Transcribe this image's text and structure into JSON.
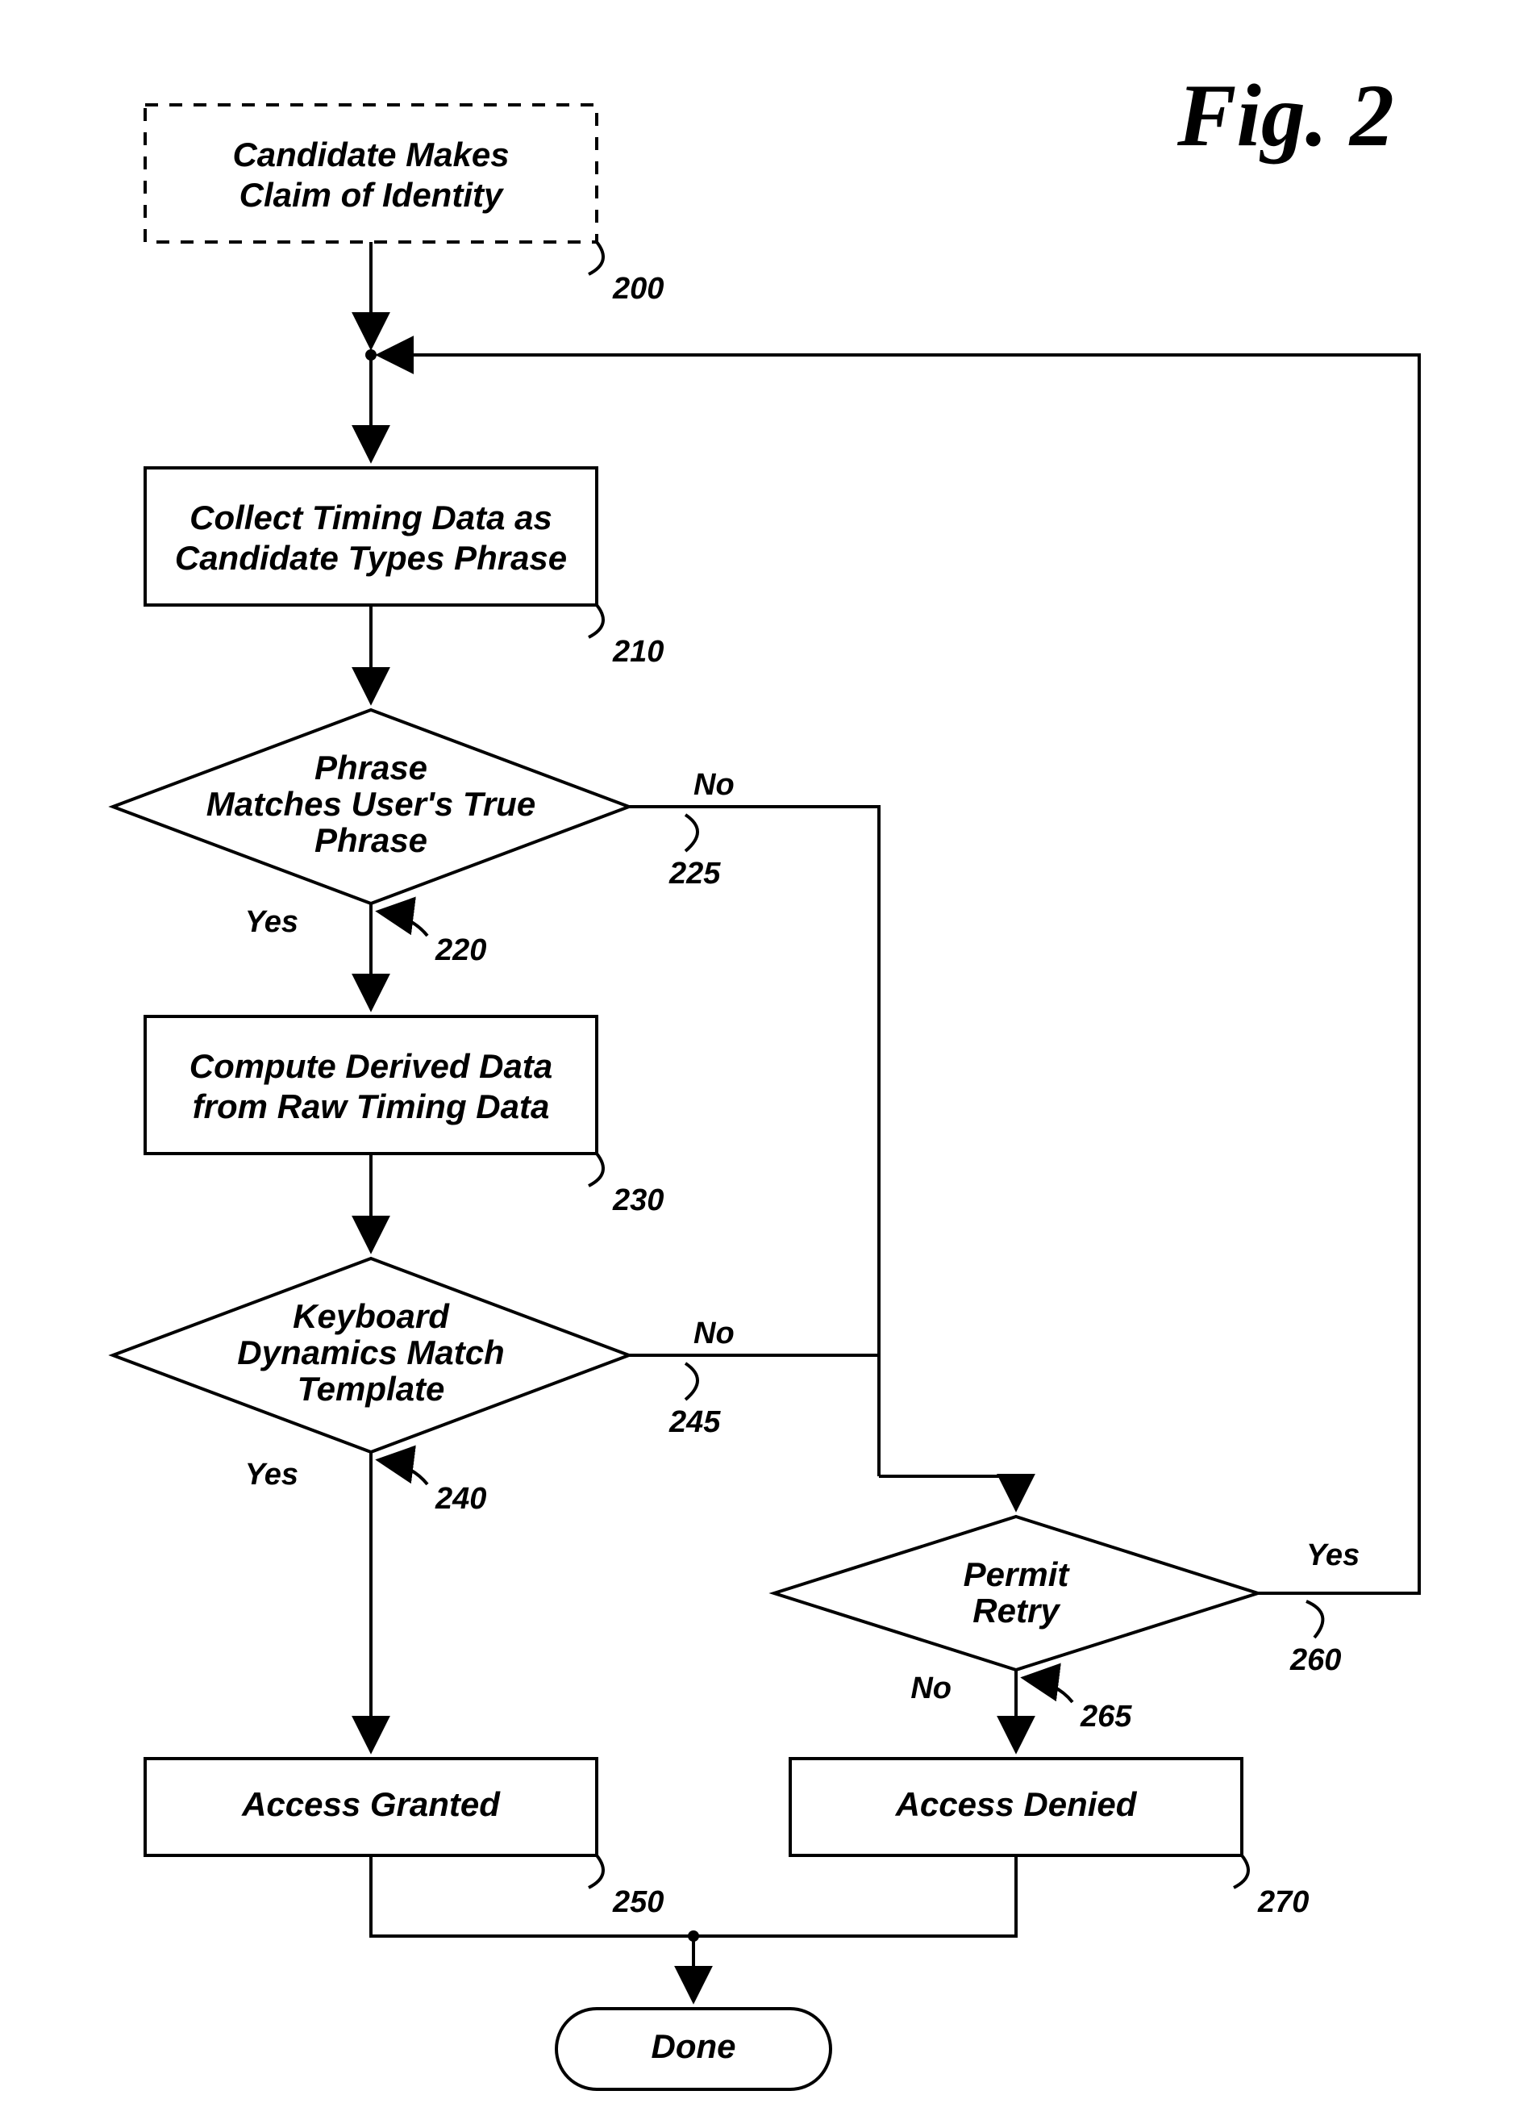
{
  "figure_label": "Fig. 2",
  "nodes": {
    "n200": {
      "l1": "Candidate Makes",
      "l2": "Claim of Identity",
      "ref": "200"
    },
    "n210": {
      "l1": "Collect Timing Data as",
      "l2": "Candidate Types Phrase",
      "ref": "210"
    },
    "n220": {
      "l1": "Phrase",
      "l2": "Matches User's True",
      "l3": "Phrase",
      "ref": "220",
      "yes": "Yes",
      "no": "No",
      "no_ref": "225"
    },
    "n230": {
      "l1": "Compute Derived Data",
      "l2": "from Raw Timing Data",
      "ref": "230"
    },
    "n240": {
      "l1": "Keyboard",
      "l2": "Dynamics Match",
      "l3": "Template",
      "ref": "240",
      "yes": "Yes",
      "no": "No",
      "no_ref": "245"
    },
    "n250": {
      "l1": "Access Granted",
      "ref": "250"
    },
    "n260": {
      "l1": "Permit",
      "l2": "Retry",
      "ref": "260",
      "yes": "Yes",
      "no": "No",
      "no_ref": "265"
    },
    "n270": {
      "l1": "Access Denied",
      "ref": "270"
    },
    "done": {
      "l1": "Done"
    }
  }
}
